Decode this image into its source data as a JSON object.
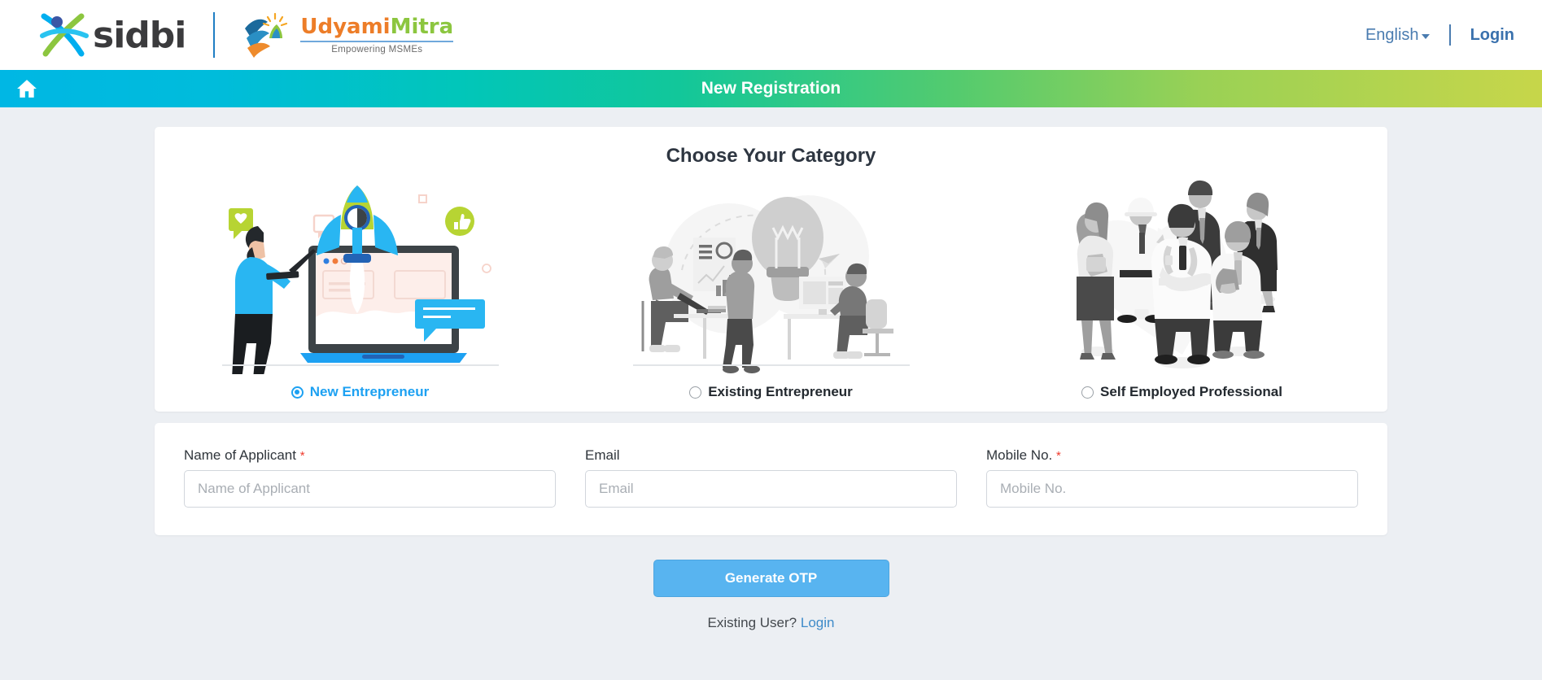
{
  "header": {
    "sidbi_logo_alt": "sidbi",
    "sidbi_wordmark": "sidbi",
    "udyami_name_part1": "Udyami",
    "udyami_name_part2": "Mitra",
    "udyami_tagline": "Empowering MSMEs",
    "language": "English",
    "login": "Login"
  },
  "banner": {
    "title": "New Registration",
    "home_icon": "home-icon"
  },
  "category": {
    "heading": "Choose Your Category",
    "options": [
      {
        "label": "New Entrepreneur",
        "selected": true,
        "illustration": "rocket-launch-laptop-illustration"
      },
      {
        "label": "Existing Entrepreneur",
        "selected": false,
        "illustration": "office-lightbulb-team-illustration"
      },
      {
        "label": "Self Employed Professional",
        "selected": false,
        "illustration": "professionals-group-illustration"
      }
    ]
  },
  "form": {
    "fields": [
      {
        "label": "Name of Applicant",
        "required": true,
        "placeholder": "Name of Applicant",
        "value": ""
      },
      {
        "label": "Email",
        "required": false,
        "placeholder": "Email",
        "value": ""
      },
      {
        "label": "Mobile No.",
        "required": true,
        "placeholder": "Mobile No.",
        "value": ""
      }
    ],
    "required_marker": "*"
  },
  "actions": {
    "generate_otp": "Generate OTP",
    "existing_user_text": "Existing User?",
    "existing_user_link": "Login"
  },
  "colors": {
    "banner_gradient_start": "#00b7e4",
    "banner_gradient_end": "#c7d64a",
    "accent_blue": "#1da1f2",
    "button_blue": "#58b4f0",
    "link_blue": "#3e8bc9",
    "required_red": "#ef3b2d",
    "page_bg": "#eceff3"
  }
}
